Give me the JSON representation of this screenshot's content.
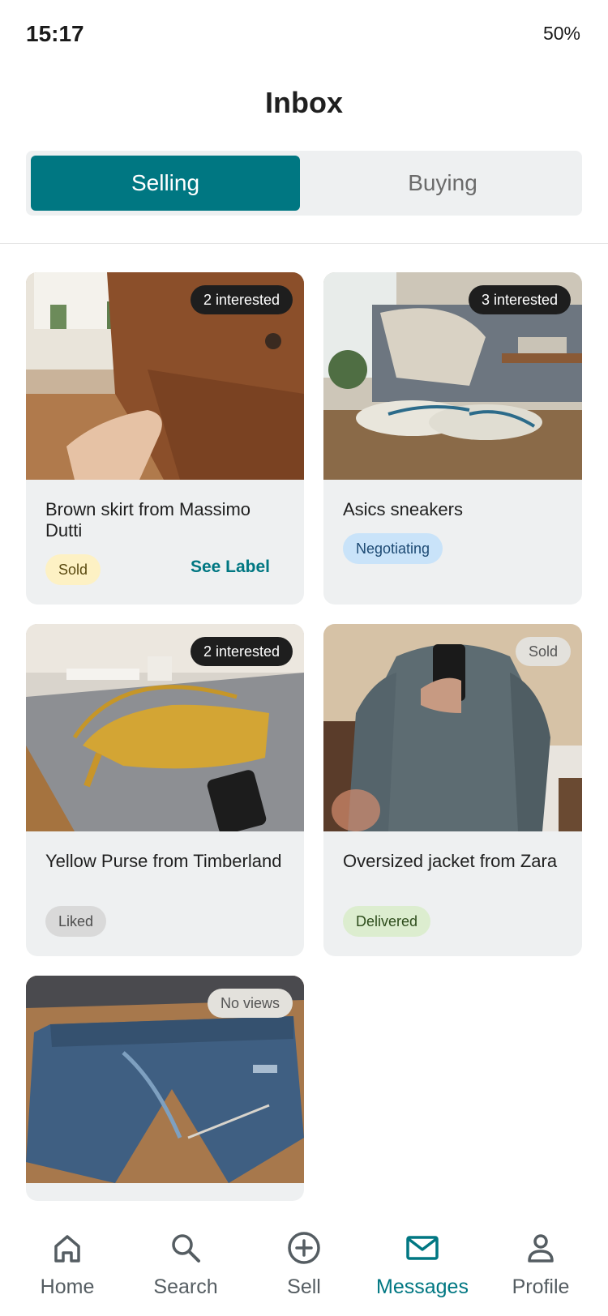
{
  "status_bar": {
    "time": "15:17",
    "battery": "50%"
  },
  "header": {
    "title": "Inbox"
  },
  "tabs": {
    "selling": "Selling",
    "buying": "Buying"
  },
  "items": [
    {
      "badge": "2 interested",
      "title": "Brown skirt from Massimo Dutti",
      "status": "Sold",
      "action": "See Label"
    },
    {
      "badge": "3 interested",
      "title": "Asics sneakers",
      "status": "Negotiating"
    },
    {
      "badge": "2 interested",
      "title": "Yellow Purse from Timberland",
      "status": "Liked"
    },
    {
      "badge": "Sold",
      "title": "Oversized jacket from Zara",
      "status": "Delivered"
    },
    {
      "badge": "No views"
    }
  ],
  "nav": {
    "home": "Home",
    "search": "Search",
    "sell": "Sell",
    "messages": "Messages",
    "profile": "Profile"
  },
  "colors": {
    "accent": "#007782",
    "card_bg": "#eef0f1",
    "sold_pill": "#fdf1c4",
    "negotiating_pill": "#c9e3f9",
    "liked_pill": "#d9d9d9",
    "delivered_pill": "#dcedcf"
  },
  "icons": [
    "home-icon",
    "search-icon",
    "plus-circle-icon",
    "envelope-icon",
    "person-icon"
  ]
}
